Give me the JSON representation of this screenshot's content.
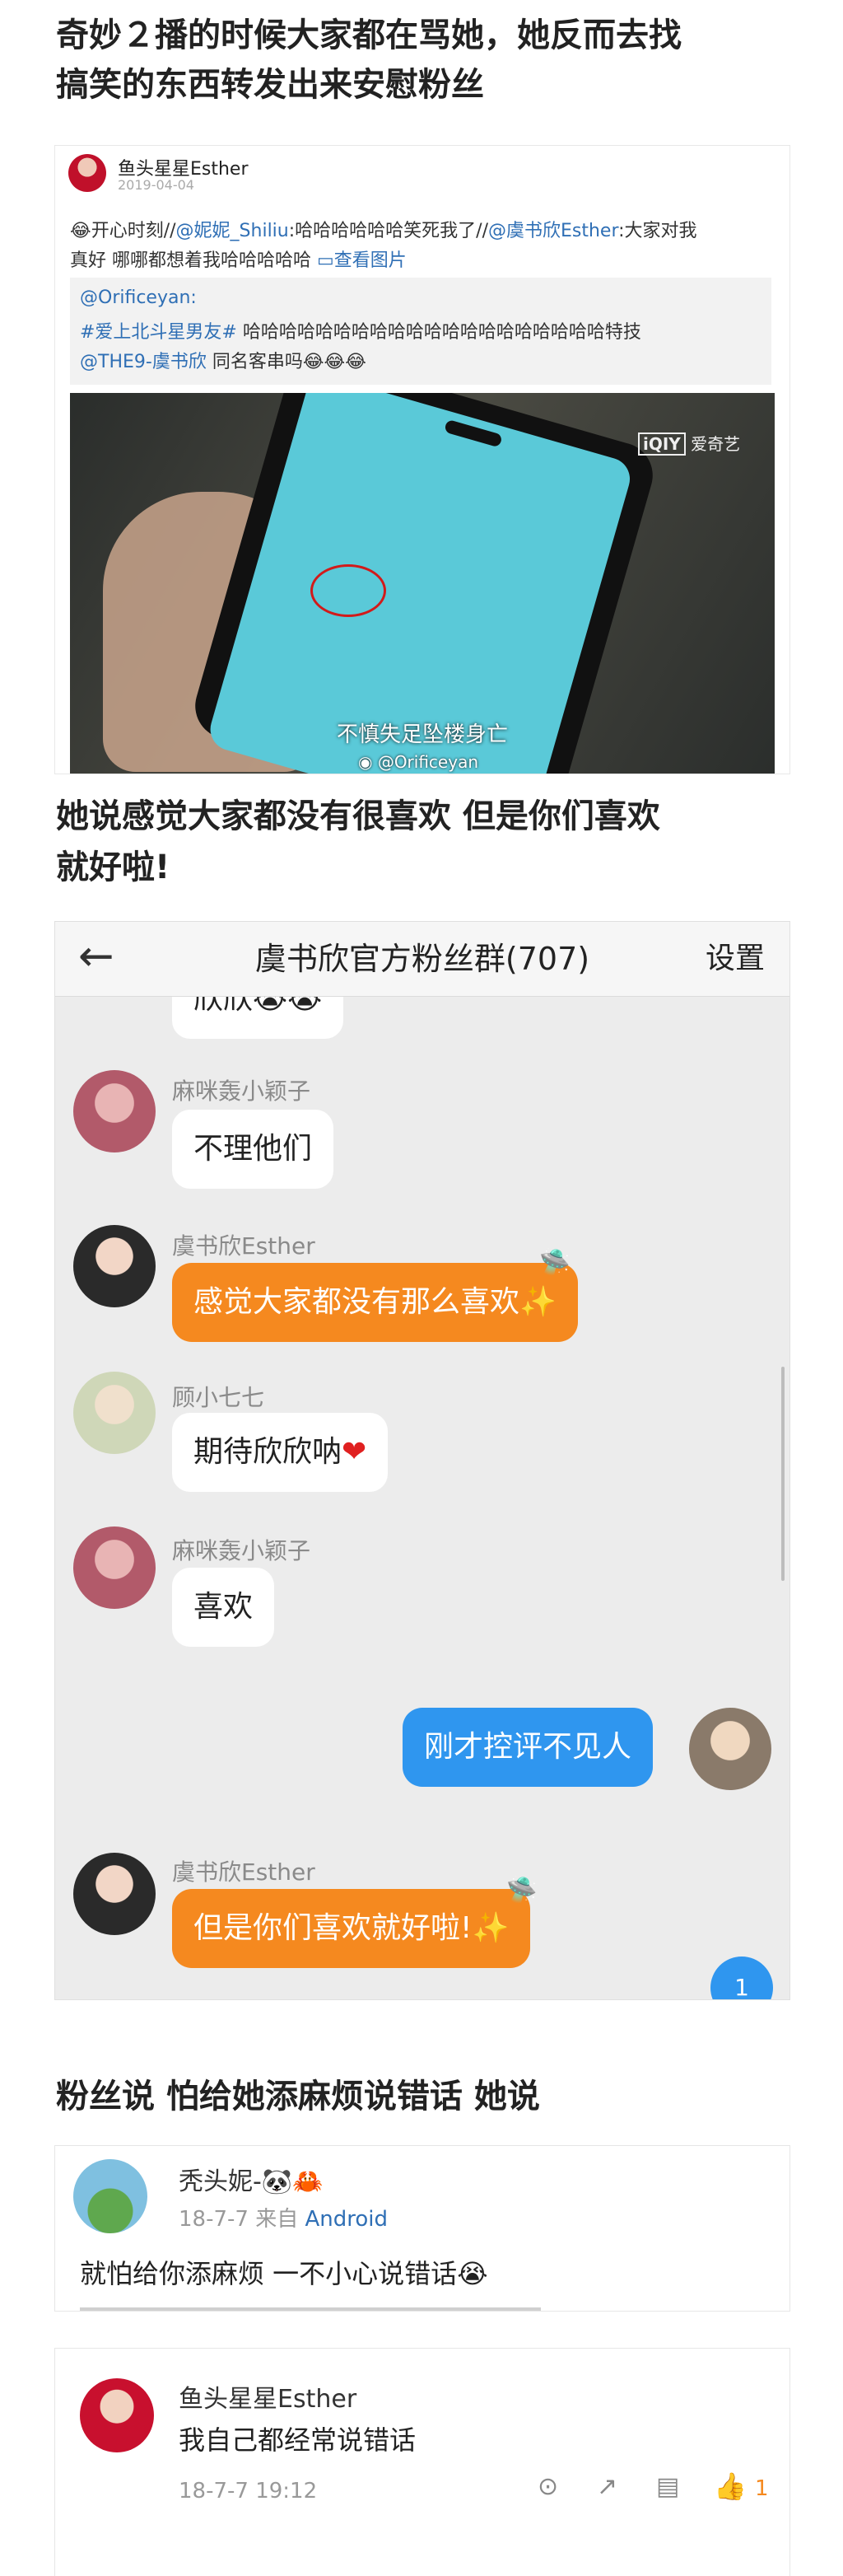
{
  "headings": {
    "h1_line1": "奇妙２播的时候大家都在骂她，她反而去找",
    "h1_line2": "搞笑的东西转发出来安慰粉丝",
    "h2_line1": "她说感觉大家都没有很喜欢 但是你们喜欢",
    "h2_line2": "就好啦!",
    "h3": "粉丝说 怕给她添麻烦说错话 她说"
  },
  "repost": {
    "username": "鱼头星星Esther",
    "date": "2019-04-04",
    "text_prefix": "开心时刻//",
    "mention1": "@妮妮_Shiliu",
    "text_mid": ":哈哈哈哈哈哈笑死我了//",
    "mention2": "@虞书欣Esther",
    "text_after": ":大家对我",
    "line2": "真好 哪哪都想着我哈哈哈哈哈",
    "view_image": "查看图片",
    "quote_user": "@Orificeyan:",
    "quote_tag": "#爱上北斗星男友#",
    "quote_text": " 哈哈哈哈哈哈哈哈哈哈哈哈哈哈哈哈哈哈哈哈特技",
    "quote_mention": "@THE9-虞书欣",
    "quote_text2": " 同名客串吗",
    "watermark_brand": "爱奇艺",
    "subtitle": "不慎失足坠楼身亡",
    "credit": "@Orificeyan"
  },
  "chat": {
    "title": "虞书欣官方粉丝群(707)",
    "settings": "设置",
    "messages": [
      {
        "name": "",
        "text": "欣欣"
      },
      {
        "name": "麻咪轰小颖子",
        "text": "不理他们"
      },
      {
        "name": "虞书欣Esther",
        "text": "感觉大家都没有那么喜欢"
      },
      {
        "name": "顾小七七",
        "text": "期待欣欣呐"
      },
      {
        "name": "麻咪轰小颖子",
        "text": "喜欢"
      },
      {
        "name": "",
        "text": "刚才控评不见人"
      },
      {
        "name": "虞书欣Esther",
        "text": "但是你们喜欢就好啦!"
      }
    ],
    "unread": "1"
  },
  "comment1": {
    "username": "秃头妮-",
    "meta": "18-7-7  来自",
    "device": "Android",
    "text": "就怕给你添麻烦 一不小心说错话"
  },
  "comment2": {
    "username": "鱼头星星Esther",
    "text": "我自己都经常说错话",
    "time": "18-7-7 19:12",
    "likes": "1"
  },
  "colors": {
    "orange": "#f5891f",
    "blue": "#2f96ef",
    "link": "#2f6fb5",
    "like": "#f5891f"
  }
}
